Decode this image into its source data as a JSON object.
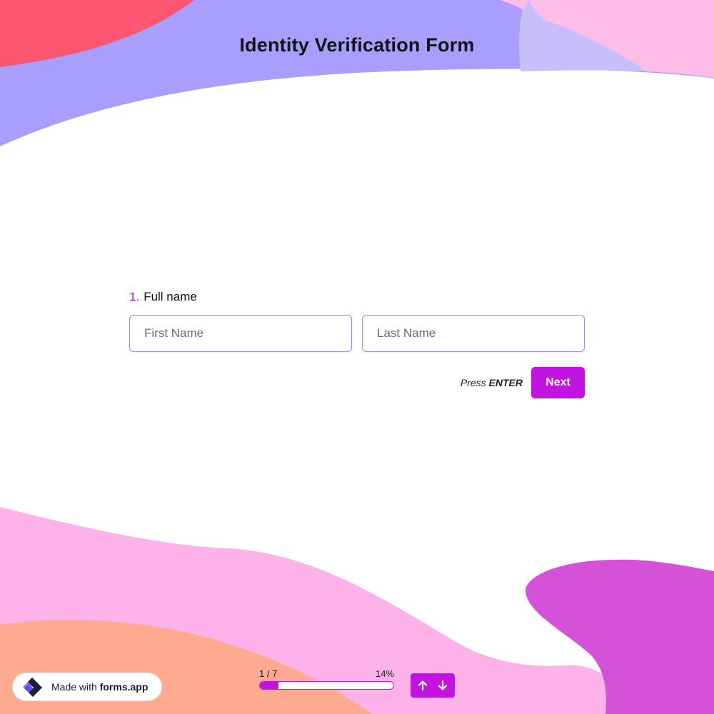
{
  "form": {
    "title": "Identity Verification Form"
  },
  "question": {
    "number": "1.",
    "label": "Full name",
    "first_name_placeholder": "First Name",
    "last_name_placeholder": "Last Name"
  },
  "actions": {
    "press_prefix": "Press",
    "press_key": "ENTER",
    "next_label": "Next"
  },
  "progress": {
    "step_text": "1 / 7",
    "percent_text": "14%",
    "fraction": 0.14
  },
  "badge": {
    "made_with": "Made with",
    "brand": "forms.app"
  },
  "icons": {
    "logo": "forms-app-logo-icon",
    "prev": "arrow-up-icon",
    "next": "arrow-down-icon"
  },
  "colors": {
    "accent": "#c313e0",
    "input_border": "#b27ef0",
    "background": "#ffffff"
  }
}
